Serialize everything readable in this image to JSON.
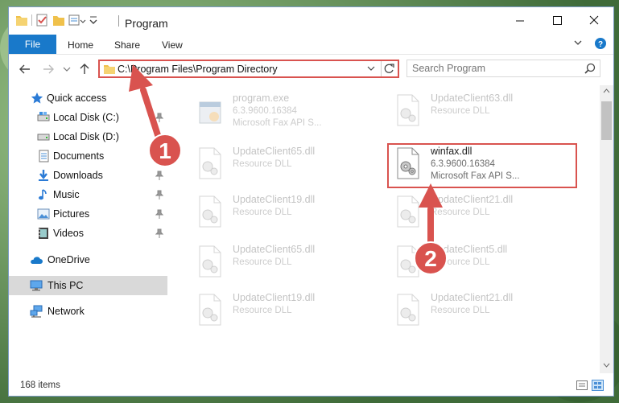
{
  "window": {
    "title": "Program",
    "buttons": {
      "minimize": "minimize-icon",
      "maximize": "maximize-icon",
      "close": "close-icon"
    }
  },
  "ribbon": {
    "tabs": [
      {
        "label": "File",
        "active": true
      },
      {
        "label": "Home"
      },
      {
        "label": "Share"
      },
      {
        "label": "View"
      }
    ]
  },
  "address": {
    "path": "C:\\Program Files\\Program Directory"
  },
  "search": {
    "placeholder": "Search Program"
  },
  "nav": {
    "items": [
      {
        "label": "Quick access",
        "icon": "star-icon"
      },
      {
        "label": "Local Disk (C:)",
        "icon": "drive-icon",
        "pinned": true
      },
      {
        "label": "Local Disk (D:)",
        "icon": "drive-icon"
      },
      {
        "label": "Documents",
        "icon": "documents-icon",
        "pinned": true
      },
      {
        "label": "Downloads",
        "icon": "downloads-icon",
        "pinned": true
      },
      {
        "label": "Music",
        "icon": "music-icon",
        "pinned": true
      },
      {
        "label": "Pictures",
        "icon": "pictures-icon",
        "pinned": true
      },
      {
        "label": "Videos",
        "icon": "videos-icon",
        "pinned": true
      },
      {
        "label": "OneDrive",
        "icon": "onedrive-icon"
      },
      {
        "label": "This PC",
        "icon": "this-pc-icon",
        "selected": true
      },
      {
        "label": "Network",
        "icon": "network-icon"
      }
    ]
  },
  "files": [
    {
      "name": "program.exe",
      "line2": "6.3.9600.16384",
      "line3": "Microsoft Fax API S...",
      "kind": "exe"
    },
    {
      "name": "UpdateClient63.dll",
      "line2": "Resource DLL",
      "line3": "",
      "kind": "dll"
    },
    {
      "name": "UpdateClient65.dll",
      "line2": "Resource DLL",
      "line3": "",
      "kind": "dll"
    },
    {
      "name": "winfax.dll",
      "line2": "6.3.9600.16384",
      "line3": "Microsoft Fax API S...",
      "kind": "dll"
    },
    {
      "name": "UpdateClient19.dll",
      "line2": "Resource DLL",
      "line3": "",
      "kind": "dll"
    },
    {
      "name": "UpdateClient21.dll",
      "line2": "Resource DLL",
      "line3": "",
      "kind": "dll"
    },
    {
      "name": "UpdateClient65.dll",
      "line2": "Resource DLL",
      "line3": "",
      "kind": "dll"
    },
    {
      "name": "UpdateClient5.dll",
      "line2": "Resource DLL",
      "line3": "",
      "kind": "dll"
    },
    {
      "name": "UpdateClient19.dll",
      "line2": "Resource DLL",
      "line3": "",
      "kind": "dll"
    },
    {
      "name": "UpdateClient21.dll",
      "line2": "Resource DLL",
      "line3": "",
      "kind": "dll"
    }
  ],
  "status": {
    "item_count": "168 items"
  },
  "annotations": {
    "step1": "1",
    "step2": "2",
    "color": "#d9534f"
  },
  "colors": {
    "accent": "#1979ca",
    "selection": "#d9d9d9"
  }
}
